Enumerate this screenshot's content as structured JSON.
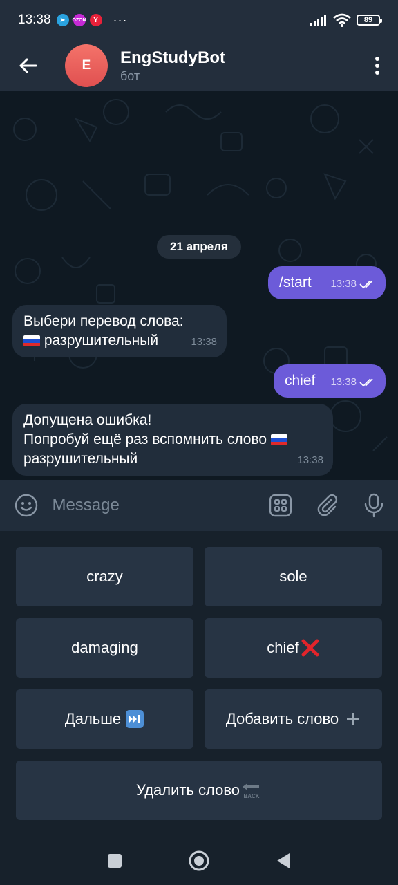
{
  "status_bar": {
    "time": "13:38",
    "notif_tg_glyph": "➤",
    "notif_ozon_text": "OZON",
    "notif_ya_text": "Y",
    "more_dots": "···",
    "battery": "89"
  },
  "header": {
    "avatar_letter": "E",
    "title": "EngStudyBot",
    "subtitle": "бот",
    "avatar_color": "#e8575a"
  },
  "chat": {
    "date": "21 апреля",
    "messages": [
      {
        "direction": "out",
        "text": "/start",
        "time": "13:38",
        "status": "read"
      },
      {
        "direction": "in",
        "line1": "Выбери перевод слова:",
        "line2": "разрушительный",
        "time": "13:38"
      },
      {
        "direction": "out",
        "text": "chief",
        "time": "13:38",
        "status": "read"
      },
      {
        "direction": "in",
        "line1": "Допущена ошибка!",
        "line2": "Попробуй ещё раз вспомнить слово",
        "line3": "разрушительный",
        "time": "13:38"
      }
    ]
  },
  "input": {
    "placeholder": "Message"
  },
  "keyboard": {
    "buttons": [
      {
        "label": "crazy"
      },
      {
        "label": "sole"
      },
      {
        "label": "damaging"
      },
      {
        "label": "chief",
        "suffix_icon": "cross-mark"
      },
      {
        "label": "Дальше",
        "suffix_icon": "fast-forward"
      },
      {
        "label": "Добавить слово",
        "suffix_icon": "plus"
      },
      {
        "label": "Удалить слово",
        "suffix_icon": "back-arrow"
      }
    ]
  },
  "colors": {
    "outgoing_bubble": "#6c5bd9",
    "incoming_bubble": "#212d3b",
    "header_bg": "#232e3c",
    "keyboard_button": "#273444"
  }
}
